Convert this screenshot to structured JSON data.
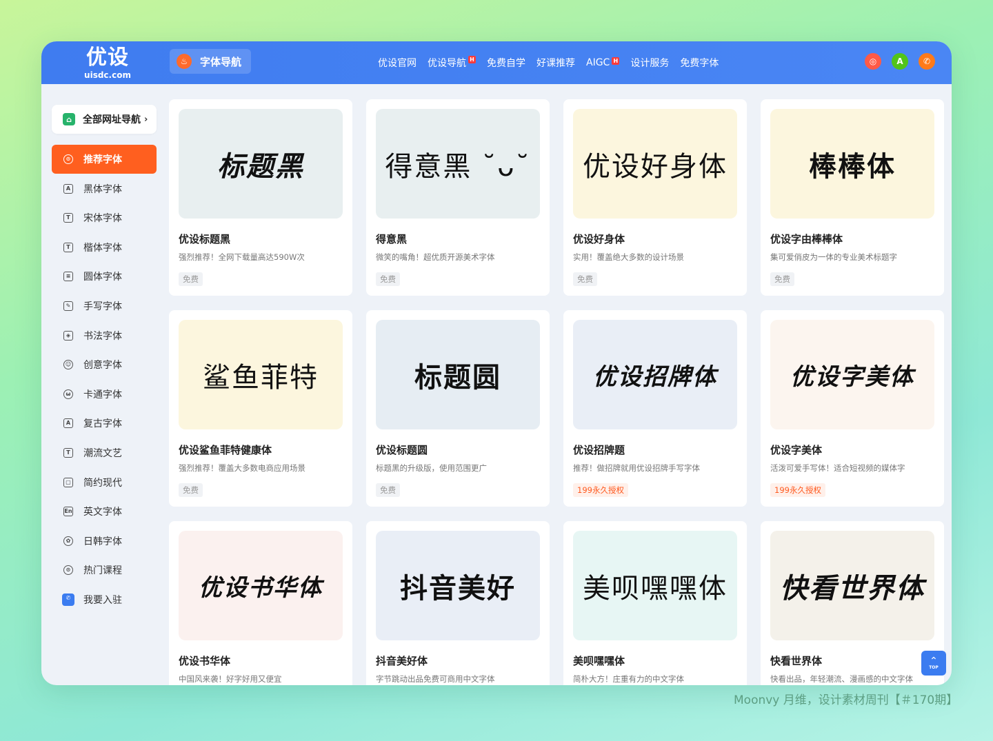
{
  "header": {
    "logo_main": "优设",
    "logo_sub": "uisdc.com",
    "section": "字体导航",
    "nav": [
      {
        "label": "优设官网",
        "hot": false
      },
      {
        "label": "优设导航",
        "hot": true
      },
      {
        "label": "免费自学",
        "hot": false
      },
      {
        "label": "好课推荐",
        "hot": false
      },
      {
        "label": "AIGC",
        "hot": true
      },
      {
        "label": "设计服务",
        "hot": false
      },
      {
        "label": "免费字体",
        "hot": false
      }
    ],
    "hot_badge": "H",
    "icons": [
      {
        "name": "red-circle-icon",
        "color": "#ff5a47",
        "glyph": "◎"
      },
      {
        "name": "green-circle-icon",
        "color": "#52c41a",
        "glyph": "A"
      },
      {
        "name": "phone-icon",
        "color": "#ff7a1a",
        "glyph": "✆"
      }
    ]
  },
  "sidebar": {
    "all_nav": "全部网址导航",
    "items": [
      {
        "label": "推荐字体",
        "icon": "⊙",
        "name": "recommended-icon",
        "active": true
      },
      {
        "label": "黑体字体",
        "icon": "A",
        "name": "heiti-icon"
      },
      {
        "label": "宋体字体",
        "icon": "T",
        "name": "songti-icon"
      },
      {
        "label": "楷体字体",
        "icon": "T",
        "name": "kaiti-icon"
      },
      {
        "label": "圆体字体",
        "icon": "≡",
        "name": "yuanti-icon"
      },
      {
        "label": "手写字体",
        "icon": "✎",
        "name": "pen-icon"
      },
      {
        "label": "书法字体",
        "icon": "◈",
        "name": "calligraphy-icon"
      },
      {
        "label": "创意字体",
        "icon": "☺",
        "name": "smile-icon"
      },
      {
        "label": "卡通字体",
        "icon": "ω",
        "name": "cartoon-icon"
      },
      {
        "label": "复古字体",
        "icon": "A",
        "name": "retro-icon"
      },
      {
        "label": "潮流文艺",
        "icon": "T",
        "name": "trend-icon"
      },
      {
        "label": "简约现代",
        "icon": "▢",
        "name": "modern-icon"
      },
      {
        "label": "英文字体",
        "icon": "En",
        "name": "english-icon"
      },
      {
        "label": "日韩字体",
        "icon": "✿",
        "name": "flower-icon"
      },
      {
        "label": "热门课程",
        "icon": "⊙",
        "name": "course-icon"
      },
      {
        "label": "我要入驻",
        "icon": "✆",
        "name": "join-icon"
      }
    ]
  },
  "cards": [
    {
      "preview": "标题黑",
      "bg": "#e8eff0",
      "title": "优设标题黑",
      "desc": "强烈推荐！全网下载量高达590W次",
      "tag": "免费",
      "paid": false
    },
    {
      "preview": "得意黑 ˘ᴗ˘",
      "bg": "#e8eff0",
      "title": "得意黑",
      "desc": "微笑的嘴角！超优质开源美术字体",
      "tag": "免费",
      "paid": false
    },
    {
      "preview": "优设好身体",
      "bg": "#fcf6de",
      "title": "优设好身体",
      "desc": "实用！覆盖绝大多数的设计场景",
      "tag": "免费",
      "paid": false
    },
    {
      "preview": "棒棒体",
      "bg": "#fcf6de",
      "title": "优设字由棒棒体",
      "desc": "集可爱俏皮为一体的专业美术标题字",
      "tag": "免费",
      "paid": false
    },
    {
      "preview": "鲨鱼菲特",
      "bg": "#fcf6de",
      "title": "优设鲨鱼菲特健康体",
      "desc": "强烈推荐！覆盖大多数电商应用场景",
      "tag": "免费",
      "paid": false
    },
    {
      "preview": "标题圆",
      "bg": "#e6edf3",
      "title": "优设标题圆",
      "desc": "标题黑的升级版，使用范围更广",
      "tag": "免费",
      "paid": false
    },
    {
      "preview": "优设招牌体",
      "bg": "#e9eef6",
      "title": "优设招牌题",
      "desc": "推荐！做招牌就用优设招牌手写字体",
      "tag": "199永久授权",
      "paid": true
    },
    {
      "preview": "优设字美体",
      "bg": "#fcf5ef",
      "title": "优设字美体",
      "desc": "活泼可爱手写体！适合短视频的媒体字",
      "tag": "199永久授权",
      "paid": true
    },
    {
      "preview": "优设书华体",
      "bg": "#fbf1ef",
      "title": "优设书华体",
      "desc": "中国风来袭！好字好用又便宜",
      "tag": "",
      "paid": false
    },
    {
      "preview": "抖音美好",
      "bg": "#e9eef6",
      "title": "抖音美好体",
      "desc": "字节跳动出品免费可商用中文字体",
      "tag": "",
      "paid": false
    },
    {
      "preview": "美呗嘿嘿体",
      "bg": "#e7f6f4",
      "title": "美呗嘿嘿体",
      "desc": "简朴大方！庄重有力的中文字体",
      "tag": "",
      "paid": false
    },
    {
      "preview": "快看世界体",
      "bg": "#f4f1ea",
      "title": "快看世界体",
      "desc": "快看出品，年轻潮流、漫画感的中文字体",
      "tag": "",
      "paid": false
    }
  ],
  "scroll_top": "TOP",
  "credit": "Moonvy 月维，设计素材周刊【＃170期】"
}
